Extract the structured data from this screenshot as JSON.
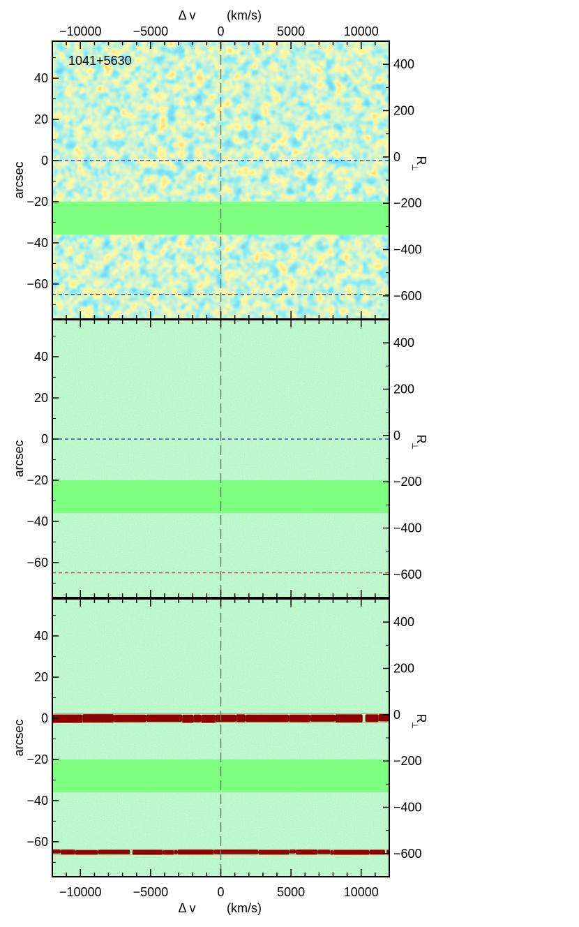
{
  "chart_data": {
    "type": "heatmap",
    "annotation": "1041+5630",
    "top_axis": {
      "label_left": "Δ v",
      "label_right": "(km/s)"
    },
    "bottom_axis": {
      "label_left": "Δ v",
      "label_right": "(km/s)"
    },
    "x_range": [
      -12000,
      12000
    ],
    "x_ticks": [
      -10000,
      -5000,
      0,
      5000,
      10000
    ],
    "x_tick_labels": [
      "−10000",
      "−5000",
      "0",
      "5000",
      "10000"
    ],
    "y_label_left": "arcsec",
    "y_label_right": "R",
    "y_label_right_subscript": "⊥",
    "y_range": [
      -77,
      58
    ],
    "y_ticks": [
      40,
      20,
      0,
      -20,
      -40,
      -60
    ],
    "y_tick_labels": [
      "40",
      "20",
      "0",
      "−20",
      "−40",
      "−60"
    ],
    "right_range": [
      -700,
      500
    ],
    "right_ticks": [
      400,
      200,
      0,
      -200,
      -400,
      -600
    ],
    "right_tick_labels": [
      "400",
      "200",
      "0",
      "−200",
      "−400",
      "−600"
    ],
    "masked_band_arcsec": [
      -36,
      -20
    ],
    "reference_lines_arcsec": [
      0,
      -65
    ],
    "panels": [
      {
        "id": "smoothed",
        "description_kind": "smoothed noise map",
        "hline_0_color": "#1f2fb0",
        "hline_m65_color": "#3a3a3a",
        "traces": []
      },
      {
        "id": "noise",
        "description_kind": "unsmoothed noise map",
        "hline_0_color": "#1f2fb0",
        "hline_m65_color": "#c0392b",
        "traces": []
      },
      {
        "id": "traces",
        "description_kind": "residual map with traces",
        "hline_0_color": null,
        "hline_m65_color": null,
        "traces": [
          0,
          -65
        ]
      }
    ],
    "colors": {
      "background": "#7fff7f",
      "low": "#1e7fd8",
      "mid": "#3fd6e6",
      "high": "#ffe43c",
      "peak": "#e63a1f",
      "trace": "#8b0000"
    }
  }
}
